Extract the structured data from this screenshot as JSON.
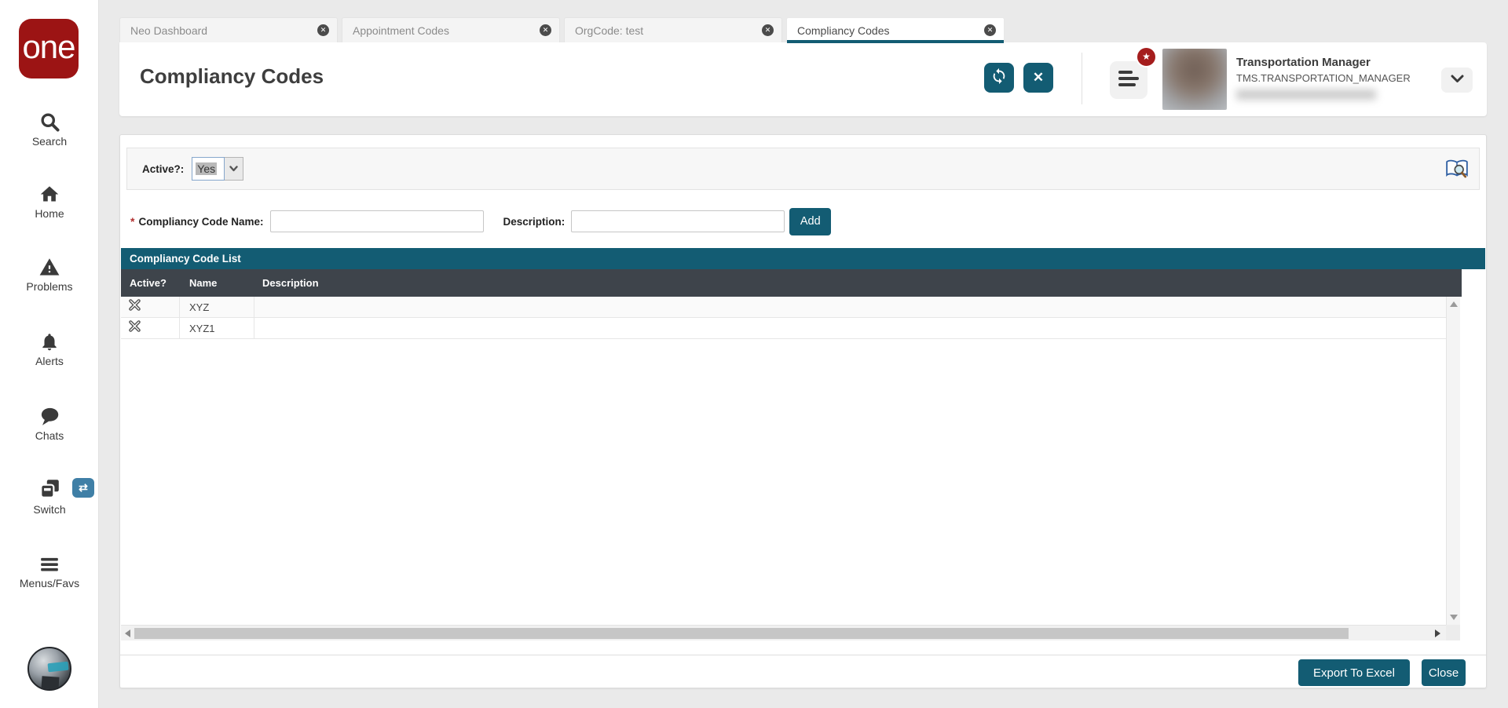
{
  "app": {
    "logo_text": "one"
  },
  "sidebar": {
    "items": [
      {
        "id": "search",
        "label": "Search"
      },
      {
        "id": "home",
        "label": "Home"
      },
      {
        "id": "problems",
        "label": "Problems"
      },
      {
        "id": "alerts",
        "label": "Alerts"
      },
      {
        "id": "chats",
        "label": "Chats"
      },
      {
        "id": "switch",
        "label": "Switch"
      },
      {
        "id": "menus",
        "label": "Menus/Favs"
      }
    ]
  },
  "tabs": [
    {
      "label": "Neo Dashboard"
    },
    {
      "label": "Appointment Codes"
    },
    {
      "label": "OrgCode: test"
    },
    {
      "label": "Compliancy Codes",
      "active": true
    }
  ],
  "header": {
    "title": "Compliancy Codes",
    "user": {
      "name": "Transportation Manager",
      "role": "TMS.TRANSPORTATION_MANAGER"
    }
  },
  "filter": {
    "active_label": "Active?:",
    "active_value": "Yes"
  },
  "form": {
    "required_marker": "*",
    "name_label": "Compliancy Code Name:",
    "name_value": "",
    "description_label": "Description:",
    "description_value": "",
    "add_label": "Add"
  },
  "table": {
    "title": "Compliancy Code List",
    "columns": [
      "Active?",
      "Name",
      "Description"
    ],
    "rows": [
      {
        "name": "XYZ",
        "description": ""
      },
      {
        "name": "XYZ1",
        "description": ""
      }
    ]
  },
  "footer": {
    "export_label": "Export To Excel",
    "close_label": "Close"
  },
  "icons": {
    "close_glyph": "✕",
    "star_glyph": "★",
    "swap_glyph": "⇄"
  },
  "colors": {
    "teal": "#135c73",
    "logo_red": "#9c1414",
    "badge_red": "#a51d1d",
    "switch_badge_blue": "#3f7fa6",
    "grid_header": "#3e444b"
  }
}
